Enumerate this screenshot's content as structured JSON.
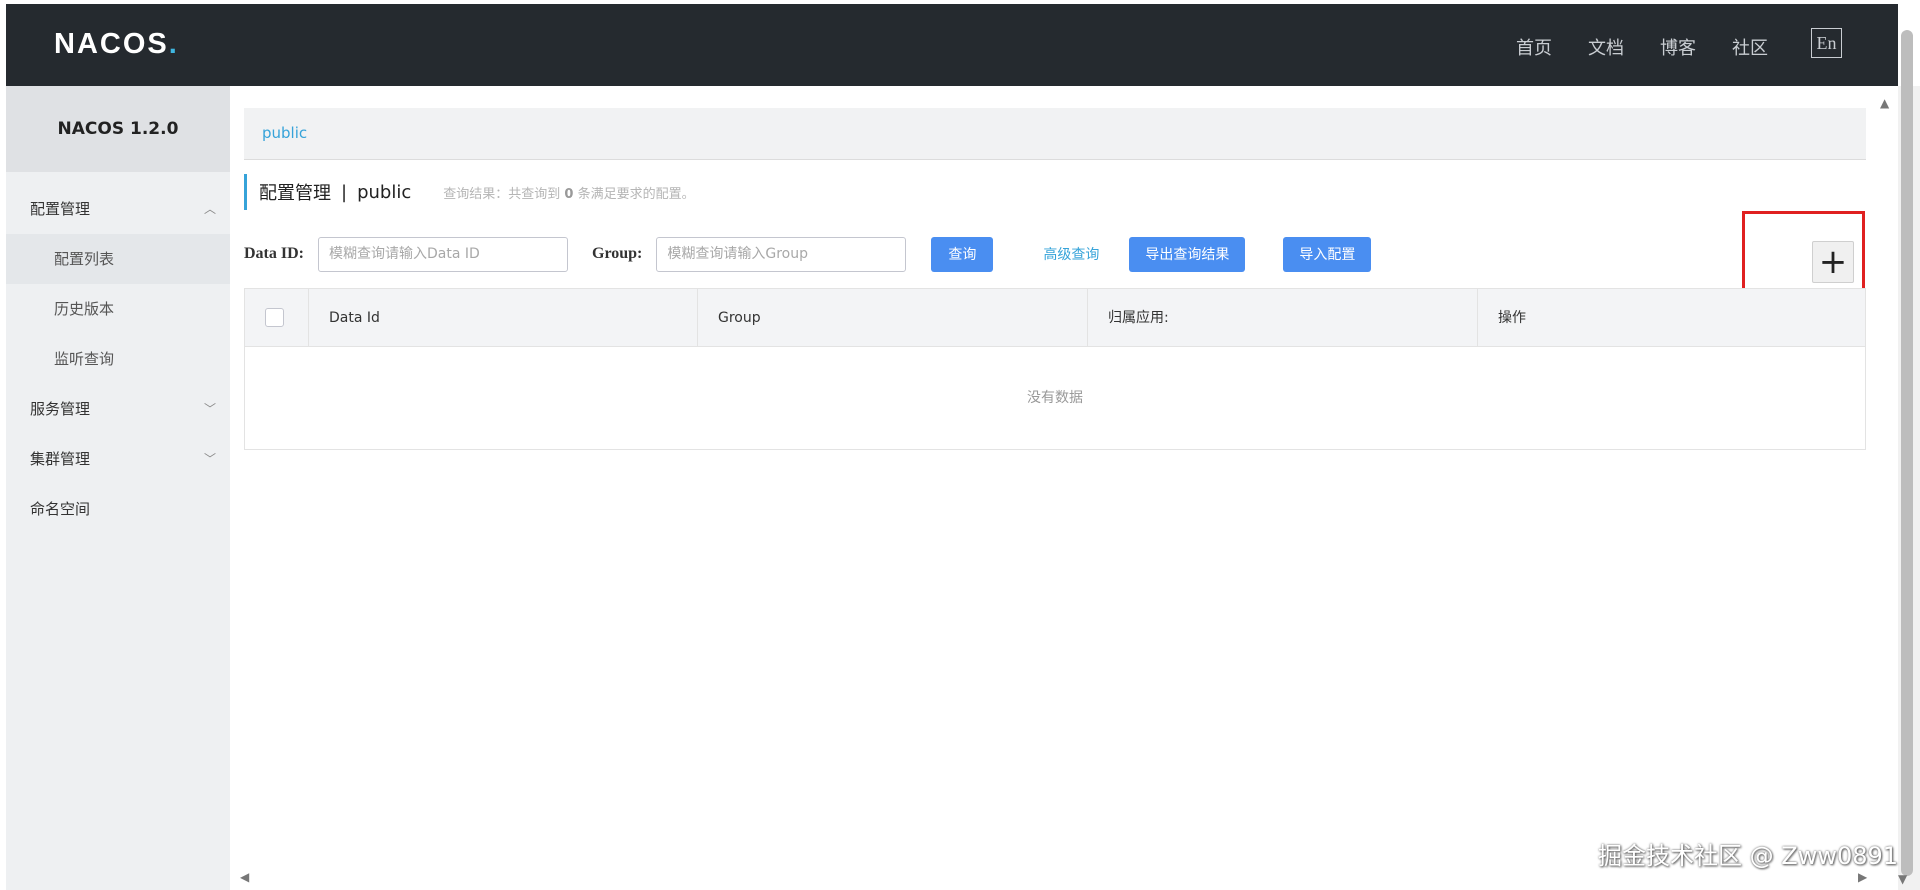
{
  "header": {
    "logo": "NACOS",
    "logo_dot": ".",
    "nav": [
      "首页",
      "文档",
      "博客",
      "社区"
    ],
    "lang": "En"
  },
  "sidebar": {
    "version": "NACOS 1.2.0",
    "items": [
      {
        "label": "配置管理",
        "type": "group",
        "chevron": "^"
      },
      {
        "label": "配置列表",
        "type": "sub"
      },
      {
        "label": "历史版本",
        "type": "sub"
      },
      {
        "label": "监听查询",
        "type": "sub"
      },
      {
        "label": "服务管理",
        "type": "group",
        "chevron": "v"
      },
      {
        "label": "集群管理",
        "type": "group",
        "chevron": "v"
      },
      {
        "label": "命名空间",
        "type": "group"
      }
    ]
  },
  "main": {
    "namespace_tab": "public",
    "title": "配置管理",
    "separator": "|",
    "namespace": "public",
    "result_prefix": "查询结果：共查询到",
    "result_count": "0",
    "result_suffix": "条满足要求的配置。",
    "filters": {
      "data_id_label": "Data ID:",
      "data_id_placeholder": "模糊查询请输入Data ID",
      "group_label": "Group:",
      "group_placeholder": "模糊查询请输入Group",
      "search_label": "查询",
      "advanced_label": "高级查询",
      "export_label": "导出查询结果",
      "import_label": "导入配置"
    },
    "add_label": "+",
    "table": {
      "columns": [
        "Data Id",
        "Group",
        "归属应用:",
        "操作"
      ],
      "empty": "没有数据"
    }
  },
  "watermark": "掘金技术社区 @ Zww0891"
}
